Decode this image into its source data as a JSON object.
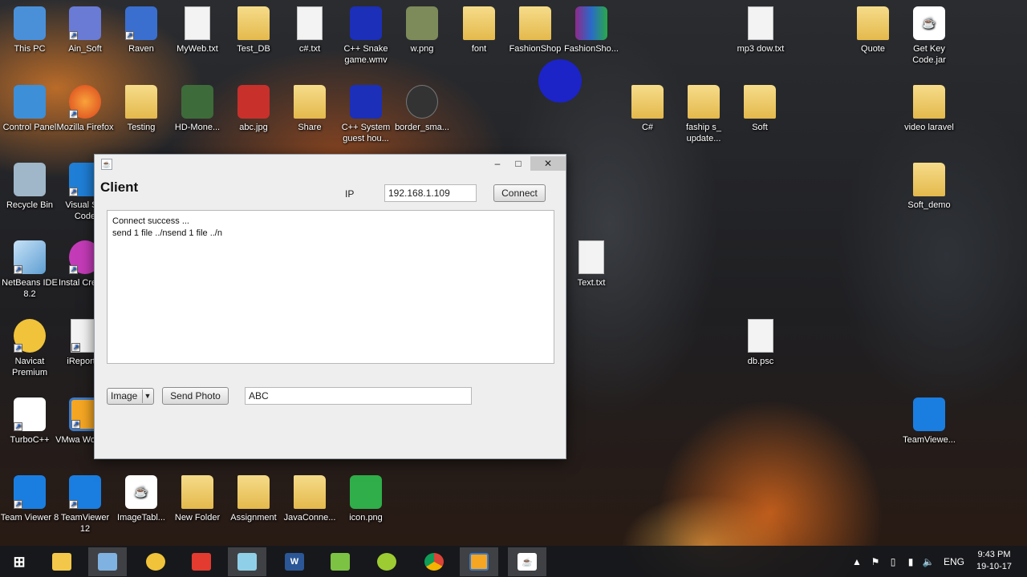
{
  "desktop_icons": [
    {
      "label": "This PC",
      "icon": "computer-icon"
    },
    {
      "label": "Ain_Soft",
      "icon": "shortcut-icon"
    },
    {
      "label": "Raven",
      "icon": "shortcut-icon"
    },
    {
      "label": "MyWeb.txt",
      "icon": "text-file-icon"
    },
    {
      "label": "Test_DB",
      "icon": "folder-icon"
    },
    {
      "label": "c#.txt",
      "icon": "text-file-icon"
    },
    {
      "label": "C++ Snake game.wmv",
      "icon": "video-file-icon"
    },
    {
      "label": "w.png",
      "icon": "image-file-icon"
    },
    {
      "label": "font",
      "icon": "folder-icon"
    },
    {
      "label": "FashionShop",
      "icon": "folder-icon"
    },
    {
      "label": "FashionSho...",
      "icon": "archive-icon"
    },
    {
      "label": "mp3 dow.txt",
      "icon": "text-file-icon"
    },
    {
      "label": "Quote",
      "icon": "folder-icon"
    },
    {
      "label": "Get Key Code.jar",
      "icon": "java-icon"
    },
    {
      "label": "Control Panel",
      "icon": "control-panel-icon"
    },
    {
      "label": "Mozilla Firefox",
      "icon": "firefox-icon"
    },
    {
      "label": "Testing",
      "icon": "folder-icon"
    },
    {
      "label": "HD-Mone...",
      "icon": "image-file-icon"
    },
    {
      "label": "abc.jpg",
      "icon": "image-file-icon"
    },
    {
      "label": "Share",
      "icon": "folder-icon"
    },
    {
      "label": "C++ System guest hou...",
      "icon": "video-file-icon"
    },
    {
      "label": "border_sma...",
      "icon": "image-file-icon"
    },
    {
      "label": "C#",
      "icon": "folder-icon"
    },
    {
      "label": "faship s_ update...",
      "icon": "folder-icon"
    },
    {
      "label": "Soft",
      "icon": "folder-icon"
    },
    {
      "label": "video laravel",
      "icon": "folder-icon"
    },
    {
      "label": "Recycle Bin",
      "icon": "recycle-bin-icon"
    },
    {
      "label": "Visual Stu Code",
      "icon": "vscode-icon"
    },
    {
      "label": "Soft_demo",
      "icon": "folder-icon"
    },
    {
      "label": "NetBeans IDE 8.2",
      "icon": "netbeans-icon"
    },
    {
      "label": "Instal Creator",
      "icon": "installer-icon"
    },
    {
      "label": "Text.txt",
      "icon": "text-file-icon"
    },
    {
      "label": "Navicat Premium",
      "icon": "navicat-icon"
    },
    {
      "label": "iReport-5",
      "icon": "report-icon"
    },
    {
      "label": "db.psc",
      "icon": "file-icon"
    },
    {
      "label": "TurboC++",
      "icon": "turboc-icon"
    },
    {
      "label": "VMwa Worksta",
      "icon": "vmware-icon"
    },
    {
      "label": "TeamViewe...",
      "icon": "teamviewer-icon"
    },
    {
      "label": "Team Viewer 8",
      "icon": "teamviewer-icon"
    },
    {
      "label": "TeamViewer 12",
      "icon": "teamviewer-icon"
    },
    {
      "label": "ImageTabl...",
      "icon": "java-icon"
    },
    {
      "label": "New Folder",
      "icon": "folder-icon"
    },
    {
      "label": "Assignment",
      "icon": "folder-icon"
    },
    {
      "label": "JavaConne...",
      "icon": "folder-icon"
    },
    {
      "label": "icon.png",
      "icon": "image-file-icon"
    }
  ],
  "window": {
    "title": "Client",
    "ip_label": "IP",
    "ip_value": "192.168.1.109",
    "connect_label": "Connect",
    "log_lines": [
      "Connect success ...",
      "send 1 file ../nsend 1 file ../n"
    ],
    "type_selected": "Image",
    "send_label": "Send Photo",
    "name_value": "ABC",
    "minimize_glyph": "–",
    "maximize_glyph": "□",
    "close_glyph": "✕"
  },
  "taskbar": {
    "items": [
      "start-icon",
      "file-explorer-icon",
      "netbeans-icon",
      "navicat-icon",
      "acrobat-icon",
      "notepad-icon",
      "word-icon",
      "android-icon",
      "chameleon-icon",
      "chrome-icon",
      "vmware-icon",
      "java-icon"
    ],
    "word_glyph": "W",
    "language": "ENG",
    "time": "9:43 PM",
    "date": "19-10-17"
  },
  "colors": {
    "accent": "#1b22d8",
    "window_bg": "#eeeeee",
    "taskbar_bg": "#16181c"
  }
}
